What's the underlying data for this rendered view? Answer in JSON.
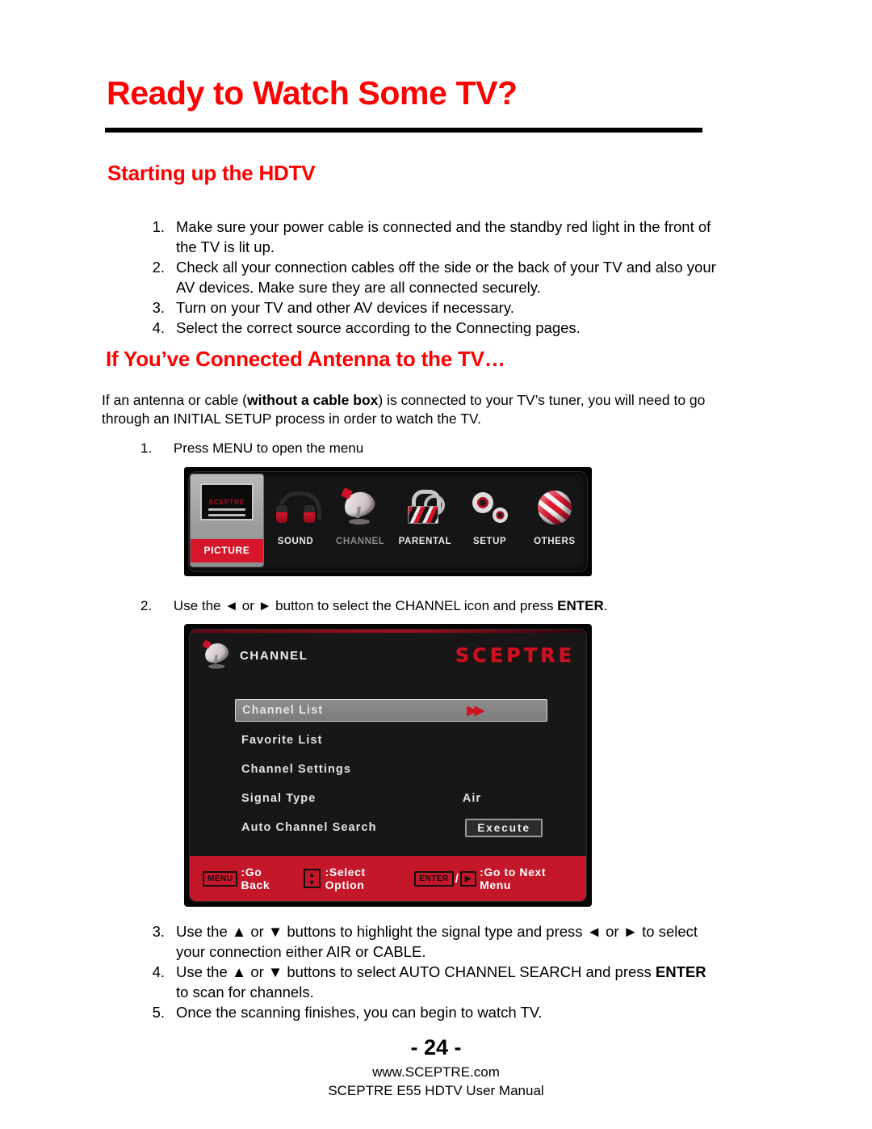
{
  "page": {
    "title": "Ready to Watch Some TV?",
    "number": "- 24 -",
    "website": "www.SCEPTRE.com",
    "manual": "SCEPTRE E55 HDTV User Manual",
    "accent_red": "#FE0000"
  },
  "section_startup": {
    "heading": "Starting up the HDTV",
    "steps": [
      "Make sure your power cable is connected and the standby red light in the front of the TV is lit up.",
      "Check all your connection cables off the side or the back of your TV and also your AV devices.  Make sure they are all connected securely.",
      "Turn on your TV and other AV devices if necessary.",
      "Select the correct source according to the Connecting pages."
    ],
    "numbers": [
      "1.",
      "2.",
      "3.",
      "4."
    ]
  },
  "section_antenna": {
    "heading": "If You’ve Connected Antenna to the TV…",
    "intro_part1": "If an antenna or cable (",
    "intro_bold": "without a cable box",
    "intro_part2": ") is connected to your TV’s tuner, you will need to go through an INITIAL SETUP process in order to watch the TV.",
    "step1_number": "1.",
    "step1_text": "Press MENU to open the menu",
    "step2_number": "2.",
    "step2_prefix": "Use the ◄ or ► button to select the CHANNEL icon and press ",
    "step2_bold": "ENTER",
    "step2_suffix": ".",
    "steps_tail": [
      {
        "num": "3.",
        "pre": "Use the ▲ or ▼ buttons to highlight the signal type and press ◄ or ► to select your connection either AIR or CABLE.",
        "bold": "",
        "post": ""
      },
      {
        "num": "4.",
        "pre": "Use the ▲ or ▼ buttons to select AUTO CHANNEL SEARCH and press ",
        "bold": "ENTER",
        "post": " to scan for channels."
      },
      {
        "num": "5.",
        "pre": "Once the scanning finishes, you can begin to watch TV.",
        "bold": "",
        "post": ""
      }
    ]
  },
  "osd_main_menu": {
    "selected": "PICTURE",
    "disabled": "CHANNEL",
    "tv_screen_text": "SCEPTRE",
    "items": [
      {
        "label": "PICTURE",
        "icon": "tv-monitor-icon"
      },
      {
        "label": "SOUND",
        "icon": "headphones-icon"
      },
      {
        "label": "CHANNEL",
        "icon": "satellite-dish-icon"
      },
      {
        "label": "PARENTAL",
        "icon": "padlock-icon"
      },
      {
        "label": "SETUP",
        "icon": "gears-icon"
      },
      {
        "label": "OTHERS",
        "icon": "striped-globe-icon"
      }
    ]
  },
  "osd_channel_menu": {
    "title": "CHANNEL",
    "logo": "SCEPTRE",
    "rows": [
      {
        "label": "Channel List",
        "value": "",
        "control": "double-arrow",
        "selected": true
      },
      {
        "label": "Favorite List",
        "value": "",
        "control": "none",
        "selected": false
      },
      {
        "label": "Channel Settings",
        "value": "",
        "control": "none",
        "selected": false
      },
      {
        "label": "Signal Type",
        "value": "Air",
        "control": "value",
        "selected": false
      },
      {
        "label": "Auto Channel Search",
        "value": "Execute",
        "control": "button",
        "selected": false
      }
    ],
    "footer": {
      "menu_key": "MENU",
      "menu_action": ":Go Back",
      "updown_up": "▲",
      "updown_down": "▼",
      "updown_action": ":Select Option",
      "enter_key": "ENTER",
      "slash": "/",
      "right_key": "▶",
      "enter_action": ":Go to Next Menu"
    }
  }
}
